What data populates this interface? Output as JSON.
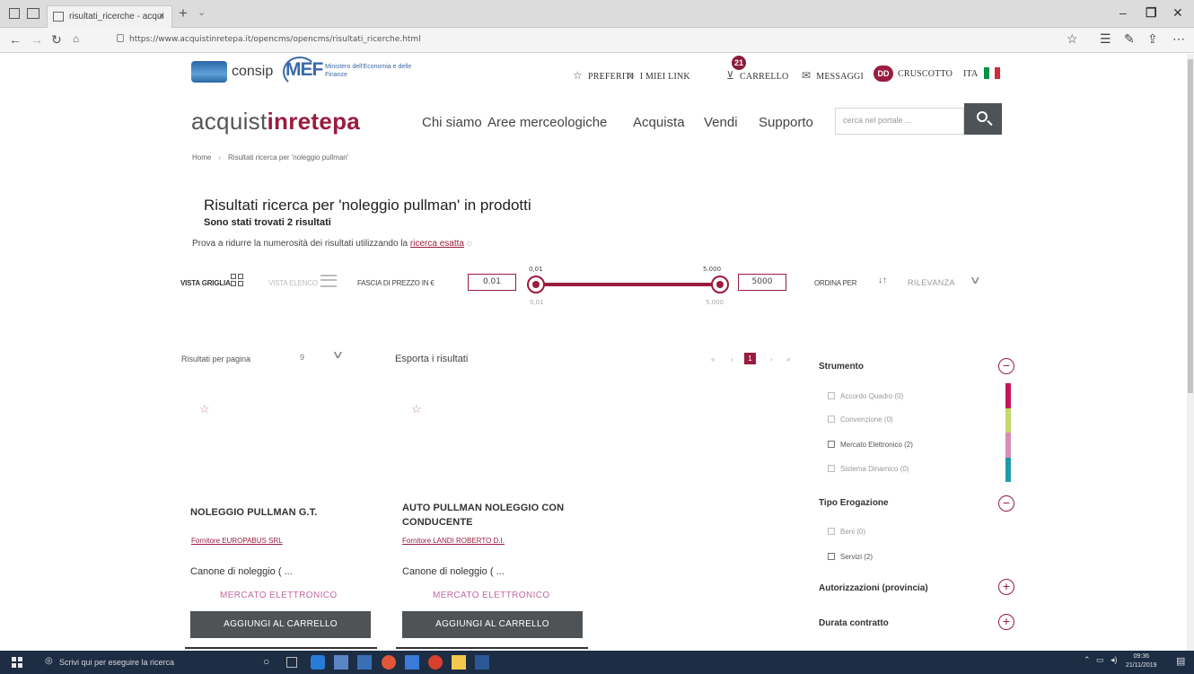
{
  "browser": {
    "tab_title": "risultati_ricerche - acqui",
    "tab_close": "×",
    "new_tab": "+",
    "tab_menu": "⌄",
    "url": "https://www.acquistinretepa.it/opencms/opencms/risultati_ricerche.html",
    "win_min": "–",
    "win_max": "❐",
    "win_close": "✕"
  },
  "top_strip": {
    "consip": "consip",
    "mef": "MEF",
    "mef_sub": "Ministero dell'Economia e delle Finanze",
    "preferiti": "PREFERITI",
    "mielink": "I MIEI LINK",
    "carrello": "CARRELLO",
    "cart_count": "21",
    "messaggi": "MESSAGGI",
    "user_initials": "DD",
    "cruscotto": "CRUSCOTTO",
    "lang": "ITA",
    "flag_colors": [
      "#009246",
      "#ffffff",
      "#ce2b37"
    ]
  },
  "header": {
    "brand_pre": "acquist",
    "brand_mid": "inrete",
    "brand_post": "pa",
    "nav": [
      "Chi siamo",
      "Aree merceologiche",
      "Acquista",
      "Vendi",
      "Supporto"
    ],
    "search_placeholder": "cerca nel portale ..."
  },
  "breadcrumb": {
    "home": "Home",
    "current": "Risultati ricerca per 'noleggio pullman'"
  },
  "results": {
    "title": "Risultati ricerca per 'noleggio pullman' in prodotti",
    "count": "Sono stati trovati 2 risultati",
    "hint_pre": "Prova a ridurre la numerosità dei risultati utilizzando la",
    "hint_link": "ricerca esatta"
  },
  "filterbar": {
    "vista_griglia": "VISTA GRIGLIA",
    "vista_elenco": "VISTA ELENCO",
    "fascia": "FASCIA DI PREZZO IN €",
    "price_min": "0.01",
    "price_max": "5000",
    "slider_min_top": "0,01",
    "slider_min_bottom": "0,01",
    "slider_max_top": "5.000",
    "slider_max_bottom": "5.000",
    "ordina": "ORDINA PER",
    "sort_icon": "↓↑",
    "sort_value": "RILEVANZA",
    "sort_chev": "∨"
  },
  "toolbar": {
    "per_page": "Risultati per pagina",
    "per_value": "9",
    "per_chev": "∨",
    "export": "Esporta i risultati",
    "pager_first": "«",
    "pager_prev": "‹",
    "page": "1",
    "pager_next": "›",
    "pager_last": "»"
  },
  "products": [
    {
      "title": "NOLEGGIO PULLMAN G.T.",
      "supplier": "Fornitore EUROPABUS SRL",
      "desc": "Canone di noleggio ( ...",
      "market": "MERCATO ELETTRONICO",
      "button": "AGGIUNGI AL CARRELLO"
    },
    {
      "title": "AUTO PULLMAN NOLEGGIO CON CONDUCENTE",
      "supplier": "Fornitore LANDI ROBERTO D.I.",
      "desc": "Canone di noleggio ( ...",
      "market": "MERCATO ELETTRONICO",
      "button": "AGGIUNGI AL CARRELLO"
    }
  ],
  "sidebar": {
    "strumento": "Strumento",
    "strumento_items": [
      "Accordo Quadro (0)",
      "Convenzione (0)",
      "Mercato Elettronico (2)",
      "Sistema Dinamico (0)"
    ],
    "tipo": "Tipo Erogazione",
    "tipo_items": [
      "Beni (0)",
      "Servizi (2)"
    ],
    "autorizzazioni": "Autorizzazioni (provincia)",
    "durata": "Durata contratto",
    "minus": "−",
    "plus": "+",
    "bar_colors": [
      "#c2185b",
      "#c5d86d",
      "#d98cb6",
      "#1f9aa8"
    ]
  },
  "taskbar": {
    "search": "Scrivi qui per eseguire la ricerca",
    "time": "09:36",
    "date": "21/11/2019"
  }
}
